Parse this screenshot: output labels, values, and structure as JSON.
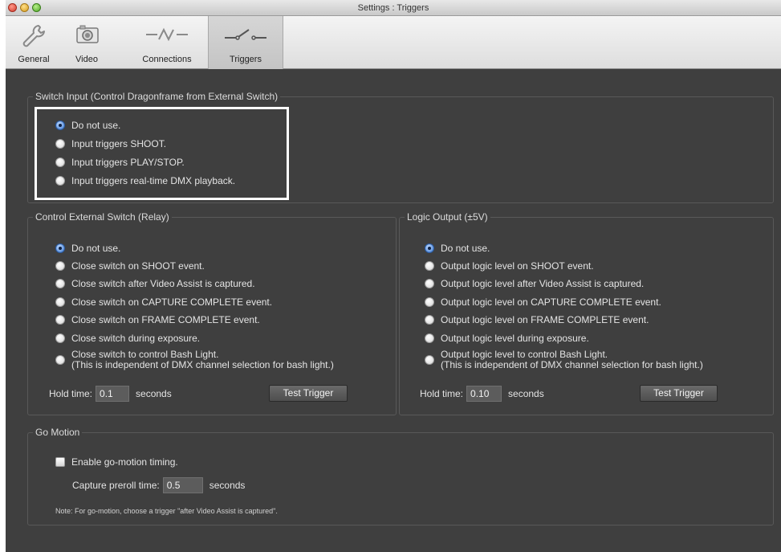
{
  "window": {
    "title": "Settings : Triggers"
  },
  "toolbar": {
    "tabs": [
      {
        "label": "General",
        "icon": "wrench-icon"
      },
      {
        "label": "Video",
        "icon": "camera-icon"
      },
      {
        "label": "Connections",
        "icon": "connection-icon"
      },
      {
        "label": "Triggers",
        "icon": "switch-icon",
        "active": true
      }
    ]
  },
  "switch_input": {
    "title": "Switch Input (Control Dragonframe from External Switch)",
    "options": [
      {
        "label": "Do not use.",
        "checked": true
      },
      {
        "label": "Input triggers SHOOT.",
        "checked": false
      },
      {
        "label": "Input triggers PLAY/STOP.",
        "checked": false
      },
      {
        "label": "Input triggers real-time DMX playback.",
        "checked": false
      }
    ]
  },
  "relay": {
    "title": "Control External Switch (Relay)",
    "options": [
      {
        "label": "Do not use.",
        "checked": true
      },
      {
        "label": "Close switch on SHOOT event.",
        "checked": false
      },
      {
        "label": "Close switch after Video Assist is captured.",
        "checked": false
      },
      {
        "label": "Close switch on CAPTURE COMPLETE event.",
        "checked": false
      },
      {
        "label": "Close switch on FRAME COMPLETE event.",
        "checked": false
      },
      {
        "label": "Close switch during exposure.",
        "checked": false
      },
      {
        "label": "Close switch to control Bash Light.",
        "label2": "(This is independent of DMX channel selection for bash light.)",
        "checked": false
      }
    ],
    "hold_label": "Hold time:",
    "hold_value": "0.1",
    "hold_unit": "seconds",
    "test_button": "Test Trigger"
  },
  "logic": {
    "title": "Logic Output (±5V)",
    "options": [
      {
        "label": "Do not use.",
        "checked": true
      },
      {
        "label": "Output logic level on SHOOT event.",
        "checked": false
      },
      {
        "label": "Output logic level after Video Assist is captured.",
        "checked": false
      },
      {
        "label": "Output logic level on CAPTURE COMPLETE event.",
        "checked": false
      },
      {
        "label": "Output logic level on FRAME COMPLETE event.",
        "checked": false
      },
      {
        "label": "Output logic level during exposure.",
        "checked": false
      },
      {
        "label": "Output logic level to control Bash Light.",
        "label2": "(This is independent of DMX channel selection for bash light.)",
        "checked": false
      }
    ],
    "hold_label": "Hold time:",
    "hold_value": "0.10",
    "hold_unit": "seconds",
    "test_button": "Test Trigger"
  },
  "go_motion": {
    "title": "Go Motion",
    "enable_label": "Enable go-motion timing.",
    "enable_checked": false,
    "preroll_label": "Capture preroll time:",
    "preroll_value": "0.5",
    "preroll_unit": "seconds",
    "note": "Note: For go-motion, choose a trigger \"after Video Assist is captured\"."
  }
}
